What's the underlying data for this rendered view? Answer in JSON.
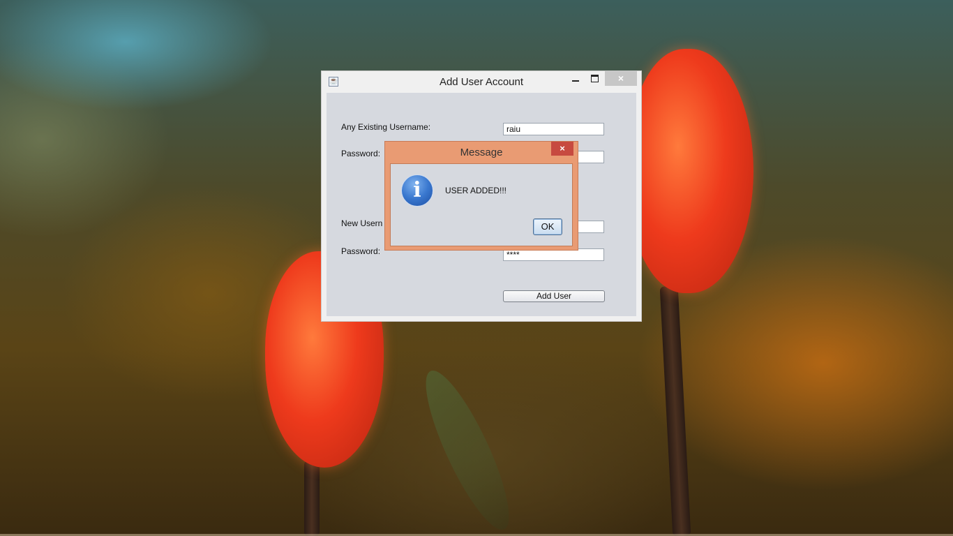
{
  "main_window": {
    "title": "Add User Account",
    "close_symbol": "×",
    "form": {
      "existing_username_label": "Any Existing Username:",
      "existing_username_value": "raiu",
      "existing_password_label": "Password:",
      "existing_password_value": "",
      "new_username_label": "New Usern",
      "new_username_value": "",
      "new_password_label": "Password:",
      "new_password_value": "****",
      "add_user_label": "Add User"
    }
  },
  "message_dialog": {
    "title": "Message",
    "close_symbol": "×",
    "icon": "info-icon",
    "icon_glyph": "i",
    "text": "USER ADDED!!!",
    "ok_label": "OK"
  },
  "colors": {
    "dialog_frame": "#e99b73",
    "dialog_close": "#c74a40",
    "window_content": "#d6d9df"
  }
}
